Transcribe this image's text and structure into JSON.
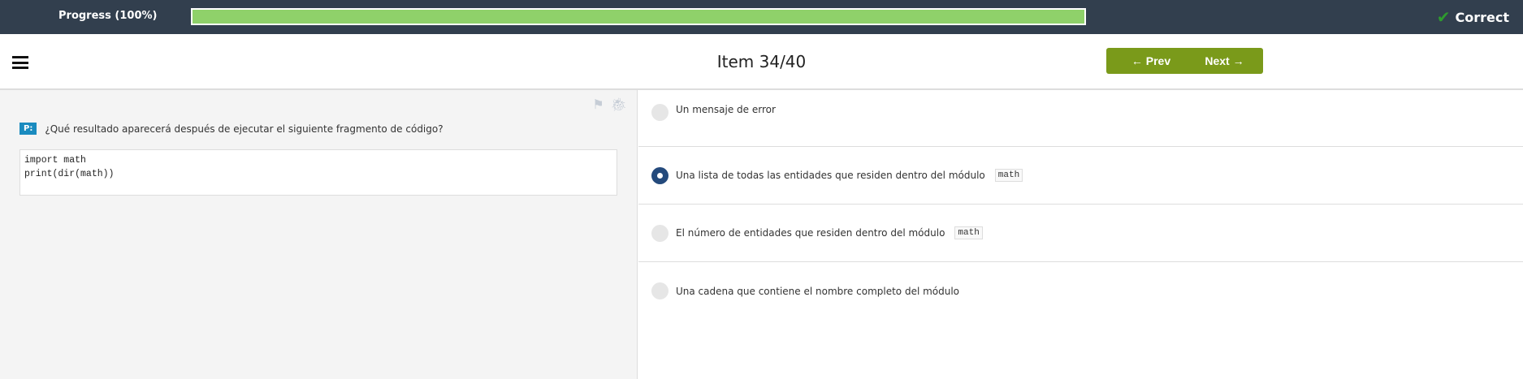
{
  "topbar": {
    "progress_label": "Progress (100%)",
    "progress_value": 100,
    "status": "Correct",
    "status_icon": "check-icon",
    "fill_color": "#8fd16a"
  },
  "header": {
    "title": "Item 34/40",
    "prev": "← Prev",
    "next": "Next →"
  },
  "question": {
    "badge": "P:",
    "text": "¿Qué resultado aparecerá después de ejecutar el siguiente fragmento de código?",
    "code": "import math\nprint(dir(math))",
    "icons": [
      "flag-icon",
      "bug-icon"
    ]
  },
  "options": [
    {
      "text": "Un mensaje de error",
      "code": "",
      "selected": false
    },
    {
      "text": "Una lista de todas las entidades que residen dentro del módulo",
      "code": "math",
      "selected": true
    },
    {
      "text": "El número de entidades que residen dentro del módulo",
      "code": "math",
      "selected": false
    },
    {
      "text": "Una cadena que contiene el nombre completo del módulo",
      "code": "",
      "selected": false
    }
  ]
}
